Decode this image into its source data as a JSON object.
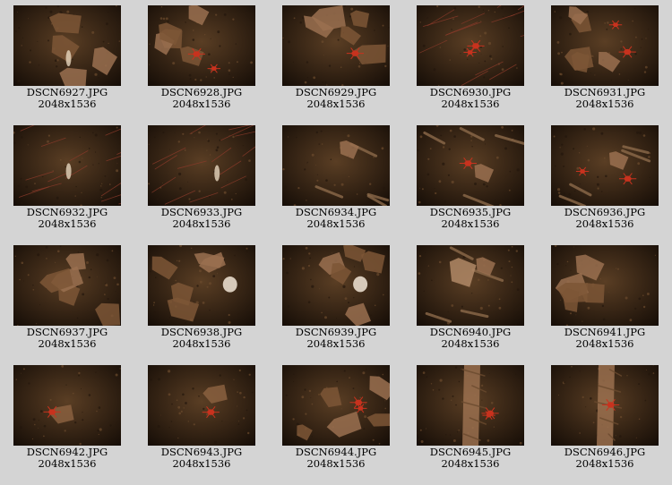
{
  "gallery": {
    "items": [
      {
        "filename": "DSCN6927.JPG",
        "dimensions": "2048x1536",
        "scene": "dark-rock"
      },
      {
        "filename": "DSCN6928.JPG",
        "dimensions": "2048x1536",
        "scene": "rock-crab"
      },
      {
        "filename": "DSCN6929.JPG",
        "dimensions": "2048x1536",
        "scene": "rock-crab"
      },
      {
        "filename": "DSCN6930.JPG",
        "dimensions": "2048x1536",
        "scene": "coral-crab"
      },
      {
        "filename": "DSCN6931.JPG",
        "dimensions": "2048x1536",
        "scene": "rock-crab"
      },
      {
        "filename": "DSCN6932.JPG",
        "dimensions": "2048x1536",
        "scene": "dark-coral"
      },
      {
        "filename": "DSCN6933.JPG",
        "dimensions": "2048x1536",
        "scene": "dark-coral"
      },
      {
        "filename": "DSCN6934.JPG",
        "dimensions": "2048x1536",
        "scene": "debris"
      },
      {
        "filename": "DSCN6935.JPG",
        "dimensions": "2048x1536",
        "scene": "debris-crab"
      },
      {
        "filename": "DSCN6936.JPG",
        "dimensions": "2048x1536",
        "scene": "debris-crab"
      },
      {
        "filename": "DSCN6937.JPG",
        "dimensions": "2048x1536",
        "scene": "rocks"
      },
      {
        "filename": "DSCN6938.JPG",
        "dimensions": "2048x1536",
        "scene": "rocks-sponge"
      },
      {
        "filename": "DSCN6939.JPG",
        "dimensions": "2048x1536",
        "scene": "rocks-sponge"
      },
      {
        "filename": "DSCN6940.JPG",
        "dimensions": "2048x1536",
        "scene": "debris-light"
      },
      {
        "filename": "DSCN6941.JPG",
        "dimensions": "2048x1536",
        "scene": "rocks"
      },
      {
        "filename": "DSCN6942.JPG",
        "dimensions": "2048x1536",
        "scene": "mud-crab"
      },
      {
        "filename": "DSCN6943.JPG",
        "dimensions": "2048x1536",
        "scene": "mud-crab"
      },
      {
        "filename": "DSCN6944.JPG",
        "dimensions": "2048x1536",
        "scene": "rocks-crab"
      },
      {
        "filename": "DSCN6945.JPG",
        "dimensions": "2048x1536",
        "scene": "column-crab"
      },
      {
        "filename": "DSCN6946.JPG",
        "dimensions": "2048x1536",
        "scene": "column-crab"
      }
    ]
  },
  "colors": {
    "page_background": "#d4d4d4",
    "label_text": "#000000",
    "seafloor_dark": "#2e2014",
    "seafloor_mid": "#5a3e24",
    "rock_light": "#9a7050",
    "crab_red": "#c8321e",
    "sponge_white": "#e8dccc"
  }
}
